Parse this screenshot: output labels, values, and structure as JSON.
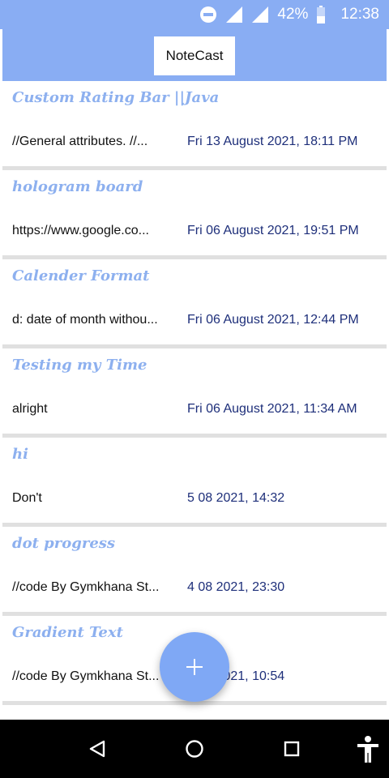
{
  "status_bar": {
    "battery_percent": "42%",
    "time": "12:38",
    "icons": [
      "dnd-icon",
      "signal-icon",
      "signal-icon",
      "battery-icon"
    ]
  },
  "app": {
    "title": "NoteCast"
  },
  "notes": [
    {
      "title": "Custom Rating Bar ||Java",
      "preview": "//General  attributes. //...",
      "date": "Fri 13 August 2021, 18:11 PM"
    },
    {
      "title": "hologram board",
      "preview": "https://www.google.co...",
      "date": "Fri 06 August 2021, 19:51 PM"
    },
    {
      "title": "Calender Format",
      "preview": "d: date of month withou...",
      "date": "Fri 06 August 2021, 12:44 PM"
    },
    {
      "title": "Testing my Time",
      "preview": "alright",
      "date": "Fri 06 August 2021, 11:34 AM"
    },
    {
      "title": "hi",
      "preview": "Don't",
      "date": "5 08 2021, 14:32"
    },
    {
      "title": "dot progress",
      "preview": "//code By Gymkhana St...",
      "date": "4 08 2021, 23:30"
    },
    {
      "title": "Gradient Text",
      "preview": "//code By Gymkhana St...",
      "date": "4 08 2021, 10:54"
    }
  ],
  "fab": {
    "icon": "plus-icon"
  },
  "nav_bar": {
    "icons": [
      "back-icon",
      "home-icon",
      "recents-icon",
      "accessibility-icon"
    ]
  }
}
